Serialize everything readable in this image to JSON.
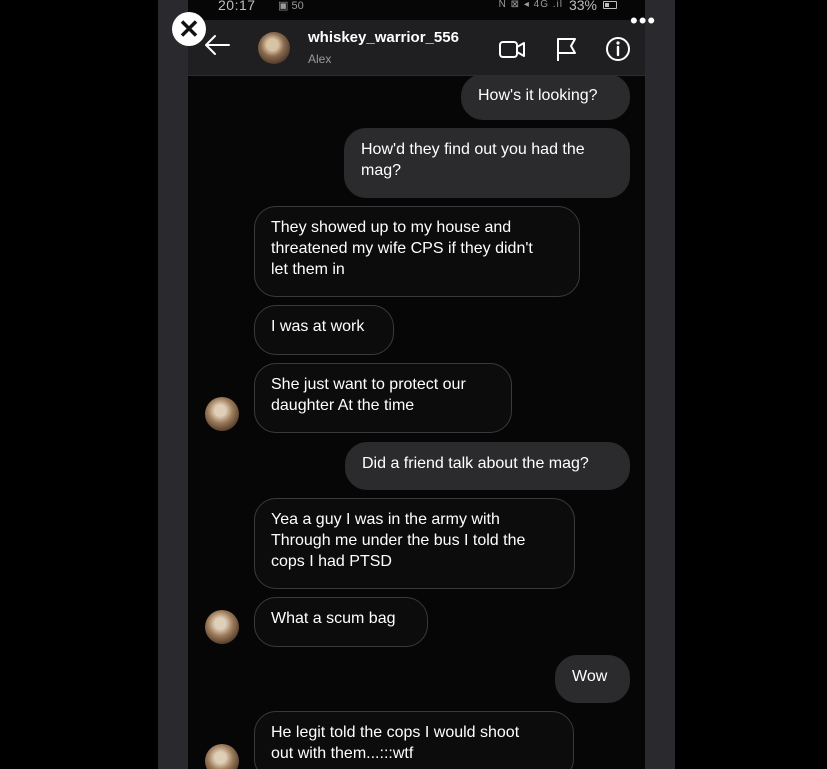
{
  "status_bar": {
    "time": "20:17",
    "left_icons": "▣ 50",
    "right_glyphs": "N ⊠ ◂ 4G .il",
    "battery": "33%"
  },
  "overlay": {
    "close_label": "✕",
    "more_label": "•••"
  },
  "header": {
    "username": "whiskey_warrior_556",
    "display_name": "Alex",
    "icons": [
      "back-arrow-icon",
      "video-camera-icon",
      "flag-icon",
      "info-icon"
    ]
  },
  "messages": [
    {
      "direction": "outgoing",
      "text": "How's it looking?"
    },
    {
      "direction": "outgoing",
      "text": "How'd they find out you had the\nmag?"
    },
    {
      "direction": "incoming",
      "text": "They showed up to my house and\nthreatened my wife CPS if they didn't\nlet them in"
    },
    {
      "direction": "incoming",
      "text": "I was at work"
    },
    {
      "direction": "incoming",
      "text": "She just want to protect our\ndaughter At the time"
    },
    {
      "direction": "outgoing",
      "text": "Did a friend talk about the mag?"
    },
    {
      "direction": "incoming",
      "text": "Yea a guy I was in the army with\nThrough me under the bus I told the\ncops I had PTSD"
    },
    {
      "direction": "incoming",
      "text": "What a scum bag"
    },
    {
      "direction": "outgoing",
      "text": "Wow"
    },
    {
      "direction": "incoming",
      "text": "He legit told the cops I would shoot\nout with them...:::wtf"
    }
  ],
  "colors": {
    "screen_bg": "#060606",
    "outgoing_bubble": "#2b2b2d",
    "incoming_border": "#3a3a3c",
    "header_bg": "#1f1f21"
  }
}
